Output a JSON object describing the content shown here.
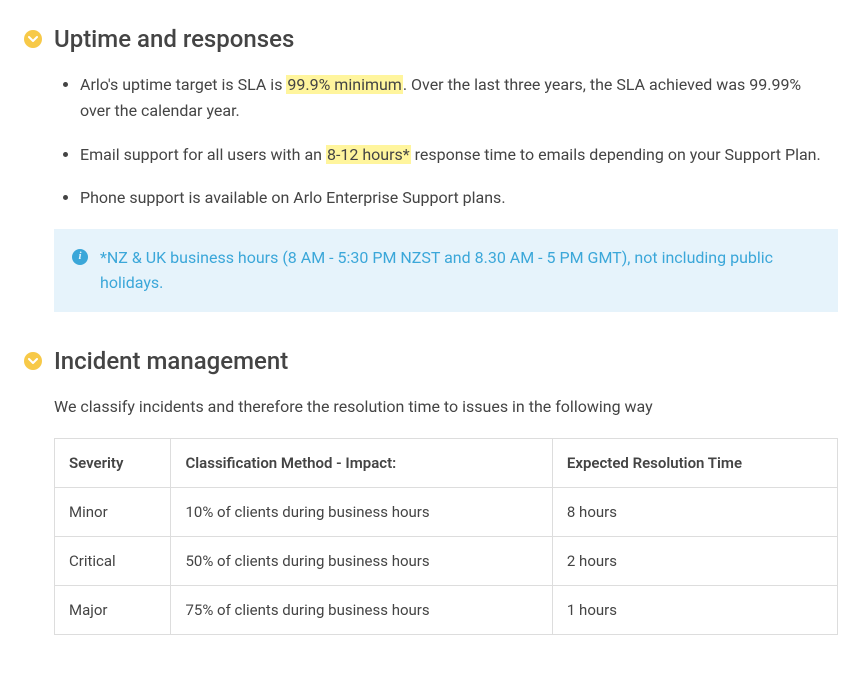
{
  "sections": {
    "uptime": {
      "title": "Uptime and responses",
      "bullets": [
        {
          "pre": "Arlo's uptime target is SLA is ",
          "hl": "99.9% minimum",
          "post": ". Over the last three years, the SLA achieved was 99.99% over the calendar year."
        },
        {
          "pre": "Email support for all users with an ",
          "hl": "8-12 hours*",
          "post": " response time to emails depending on your Support Plan."
        },
        {
          "pre": "Phone support is available on Arlo Enterprise Support plans.",
          "hl": "",
          "post": ""
        }
      ],
      "note": "*NZ & UK business hours (8 AM - 5:30 PM NZST and 8.30 AM - 5 PM  GMT), not including public holidays."
    },
    "incident": {
      "title": "Incident management",
      "intro": "We classify incidents and therefore the resolution time to issues in the following way",
      "table": {
        "headers": [
          "Severity",
          "Classification Method - Impact:",
          "Expected Resolution Time"
        ],
        "rows": [
          [
            "Minor",
            "10% of clients during business hours",
            "8 hours"
          ],
          [
            "Critical",
            "50% of clients during business hours",
            "2 hours"
          ],
          [
            "Major",
            "75% of clients during business hours",
            "1 hours"
          ]
        ]
      }
    }
  }
}
